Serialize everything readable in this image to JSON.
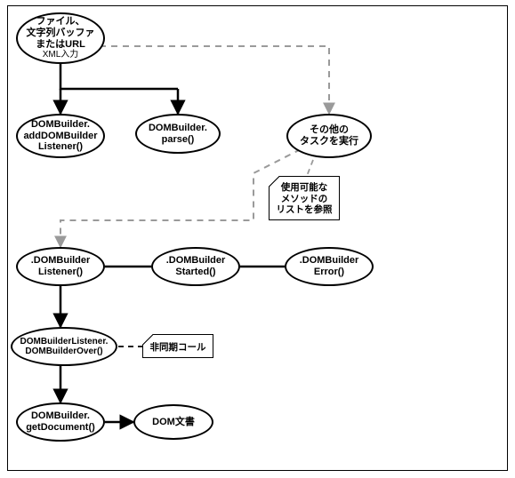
{
  "diagram": {
    "nodes": {
      "start_l1": "ファイル、",
      "start_l2": "文字列バッファ",
      "start_l3": "またはURL",
      "start_sub": "XML入力",
      "addListener_l1": "DOMBuilder.",
      "addListener_l2": "addDOMBuilder",
      "addListener_l3": "Listener()",
      "parse_l1": "DOMBuilder.",
      "parse_l2": "parse()",
      "otherTasks_l1": "その他の",
      "otherTasks_l2": "タスクを実行",
      "listener_l1": ".DOMBuilder",
      "listener_l2": "Listener()",
      "started_l1": ".DOMBuilder",
      "started_l2": "Started()",
      "error_l1": ".DOMBuilder",
      "error_l2": "Error()",
      "over_l1": "DOMBuilderListener.",
      "over_l2": "DOMBuilderOver()",
      "getDoc_l1": "DOMBuilder.",
      "getDoc_l2": "getDocument()",
      "domDoc": "DOM文書"
    },
    "notes": {
      "methods_l1": "使用可能な",
      "methods_l2": "メソッドの",
      "methods_l3": "リストを参照",
      "async": "非同期コール"
    }
  }
}
